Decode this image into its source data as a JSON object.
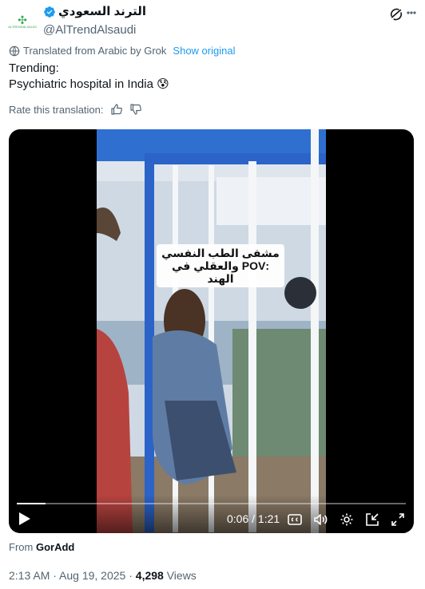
{
  "account": {
    "display_name": "الترند السعودي",
    "handle": "@AlTrendAlsaudi",
    "avatar_mark": "✣",
    "avatar_text": "ALTRENDALSAUDI"
  },
  "translation": {
    "note": "Translated from Arabic by Grok",
    "show_original": "Show original"
  },
  "tweet": {
    "text": "Trending:\nPsychiatric hospital in India 😰"
  },
  "rating": {
    "label": "Rate this translation:"
  },
  "video": {
    "overlay_caption": "مشفى الطب النفسي :POV والعقلي في الهند",
    "time": "0:06 / 1:21",
    "progress": 0.074
  },
  "footer": {
    "from_label": "From",
    "source": "GorAdd",
    "timestamp": "2:13 AM · Aug 19, 2025 · ",
    "views_count": "4,298",
    "views_label": "Views"
  },
  "colors": {
    "accent": "#1d9bf0",
    "muted": "#536471",
    "text": "#0f1419"
  }
}
